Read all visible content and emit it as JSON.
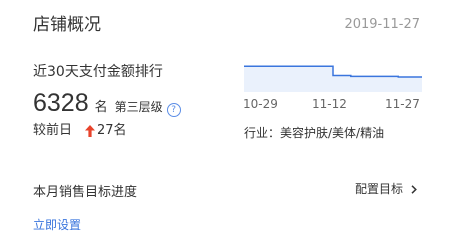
{
  "header": {
    "title": "店铺概况",
    "date": "2019-11-27"
  },
  "rank": {
    "label": "近30天支付金额排行",
    "value": "6328",
    "unit": "名",
    "tier": "第三层级",
    "help_icon": "?",
    "compare_label": "较前日",
    "compare_direction": "up",
    "compare_value": "27名"
  },
  "chart_data": {
    "type": "line",
    "x_ticks": [
      "10-29",
      "11-12",
      "11-27"
    ],
    "series": [
      {
        "relative_rank_level": [
          0.86,
          0.86,
          0.86,
          0.86,
          0.86,
          0.86,
          0.86,
          0.86,
          0.86,
          0.86,
          0.86,
          0.86,
          0.86,
          0.86,
          0.86,
          0.55,
          0.55,
          0.55,
          0.52,
          0.52,
          0.52,
          0.52,
          0.52,
          0.52,
          0.52,
          0.52,
          0.5,
          0.5,
          0.5,
          0.5
        ]
      }
    ],
    "line_color": "#3a75dd",
    "fill_color": "#eaf1fc"
  },
  "industry": {
    "text": "行业：美容护肤/美体/精油"
  },
  "target": {
    "title": "本月销售目标进度",
    "config_label": "配置目标",
    "setup_label": "立即设置"
  },
  "colors": {
    "up_arrow": "#e8432b",
    "link": "#3a75dd"
  }
}
